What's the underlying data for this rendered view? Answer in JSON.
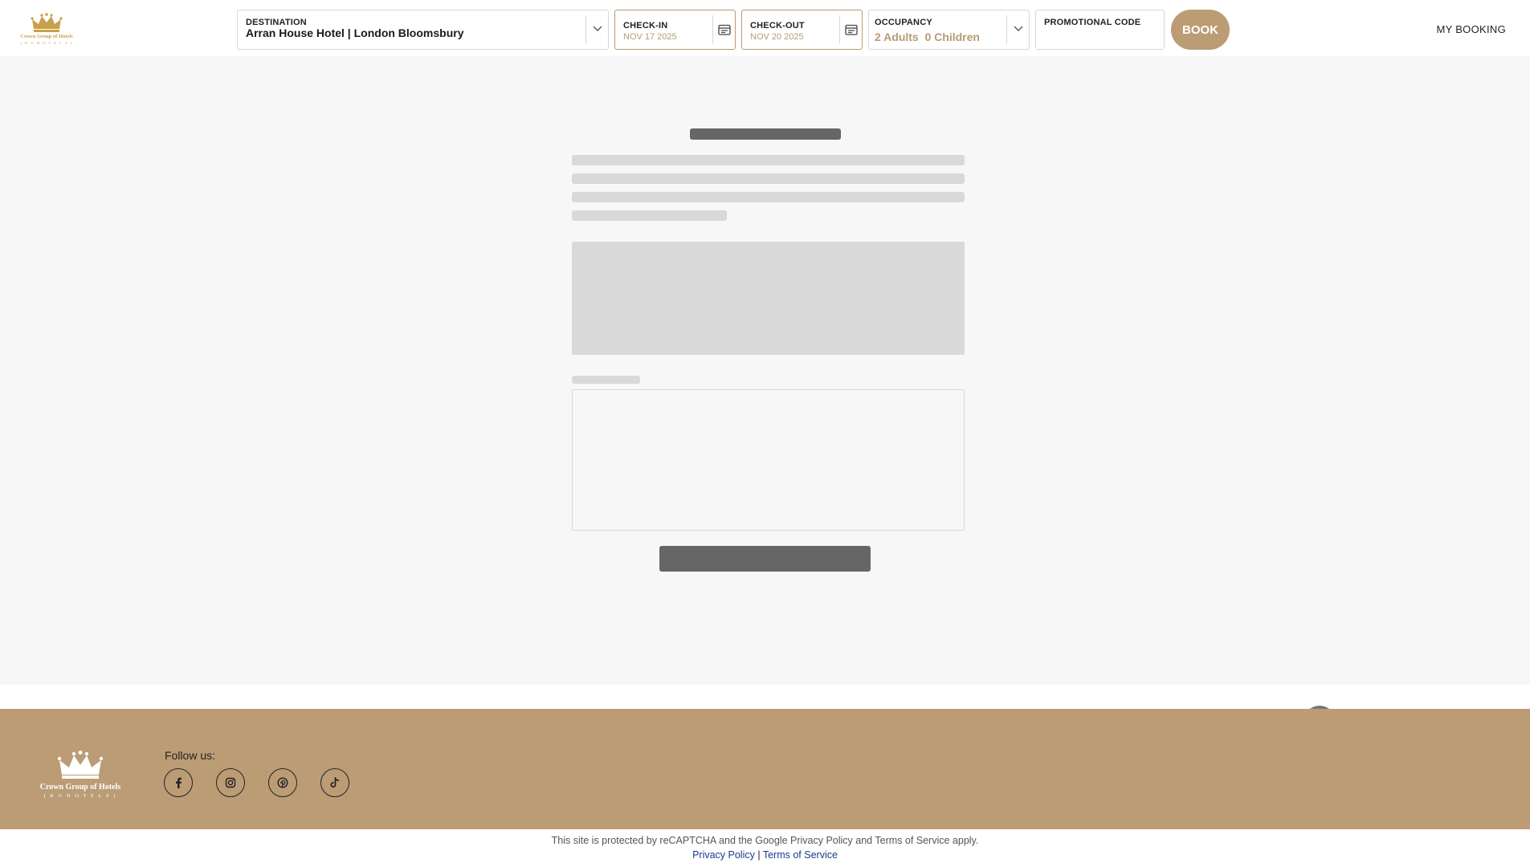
{
  "brand": {
    "name": "Crown Group of Hotels",
    "sub": "( K G H O T E L S )",
    "color": "#c9a04a"
  },
  "search": {
    "destination_label": "DESTINATION",
    "destination_value": "Arran House Hotel | London Bloomsbury",
    "checkin_label": "CHECK-IN",
    "checkin_value": "NOV 17 2025",
    "checkout_label": "CHECK-OUT",
    "checkout_value": "NOV 20 2025",
    "occupancy_label": "OCCUPANCY",
    "occupancy_adults": "2 Adults",
    "occupancy_children": "0 Children",
    "promo_label": "PROMOTIONAL CODE",
    "promo_value": "",
    "book_label": "BOOK"
  },
  "nav": {
    "my_booking": "MY BOOKING"
  },
  "footer": {
    "follow_label": "Follow us:",
    "socials": [
      "facebook-icon",
      "instagram-icon",
      "pinterest-icon",
      "tiktok-icon"
    ],
    "background": "#bb9c75"
  },
  "legal": {
    "notice": "This site is protected by reCAPTCHA and the Google Privacy Policy and Terms of Service apply.",
    "privacy_link": "Privacy Policy",
    "separator": "|",
    "terms_link": "Terms of Service"
  },
  "colors": {
    "accent": "#bb9c75",
    "loading_dark": "#666666",
    "loading_light": "#d9d9d9"
  }
}
